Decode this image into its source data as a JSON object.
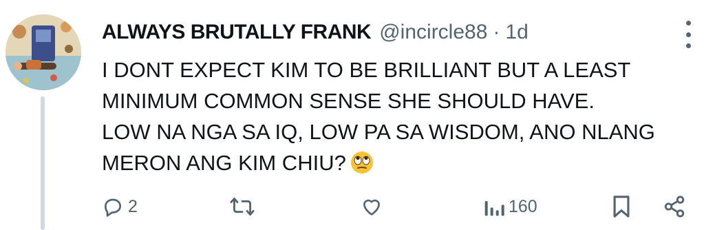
{
  "tweet": {
    "display_name": "ALWAYS BRUTALLY FRANK",
    "handle": "@incircle88",
    "separator": "·",
    "time": "1d",
    "text_lines": [
      "I DONT EXPECT KIM TO BE BRILLIANT BUT A LEAST",
      "MINIMUM COMMON SENSE SHE SHOULD HAVE.",
      "LOW NA NGA SA IQ, LOW PA SA WISDOM, ANO NLANG",
      "MERON ANG KIM CHIU?"
    ],
    "emoji": "face-with-rolling-eyes"
  },
  "actions": {
    "reply_count": "2",
    "views_count": "160"
  },
  "colors": {
    "text": "#0f1419",
    "secondary": "#536471",
    "thread_line": "#cfd9de",
    "emoji": "#f7c236"
  }
}
